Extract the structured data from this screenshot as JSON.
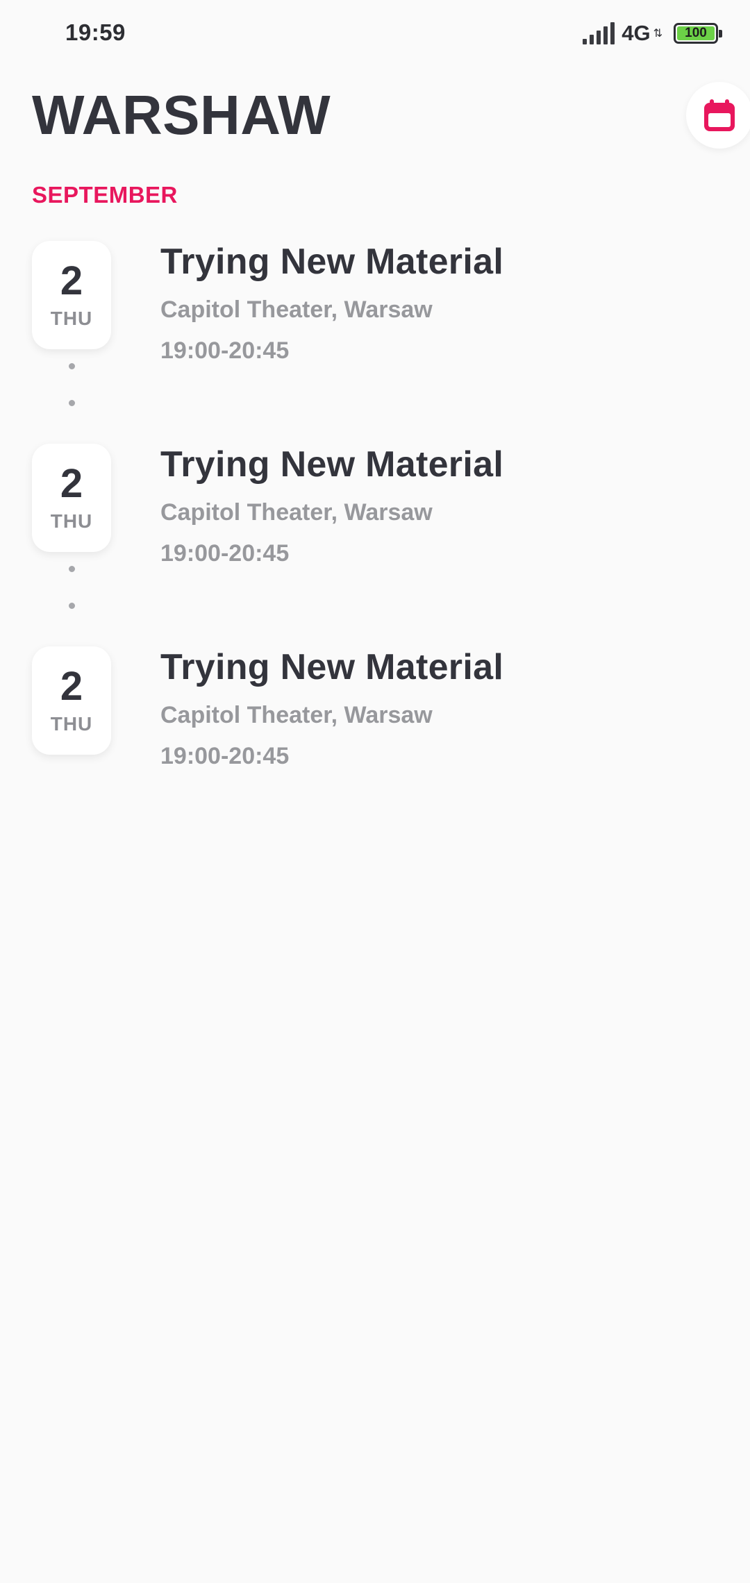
{
  "status_bar": {
    "time": "19:59",
    "network": "4G",
    "battery": "100",
    "battery_color": "#6cd147"
  },
  "header": {
    "title": "WARSHAW",
    "calendar_icon": "calendar-icon",
    "accent_color": "#e8175d"
  },
  "month": "SEPTEMBER",
  "events": [
    {
      "day": "2",
      "weekday": "THU",
      "title": "Trying New Material",
      "venue": "Capitol Theater, Warsaw",
      "time": "19:00-20:45"
    },
    {
      "day": "2",
      "weekday": "THU",
      "title": "Trying New Material",
      "venue": "Capitol Theater, Warsaw",
      "time": "19:00-20:45"
    },
    {
      "day": "2",
      "weekday": "THU",
      "title": "Trying New Material",
      "venue": "Capitol Theater, Warsaw",
      "time": "19:00-20:45"
    }
  ]
}
